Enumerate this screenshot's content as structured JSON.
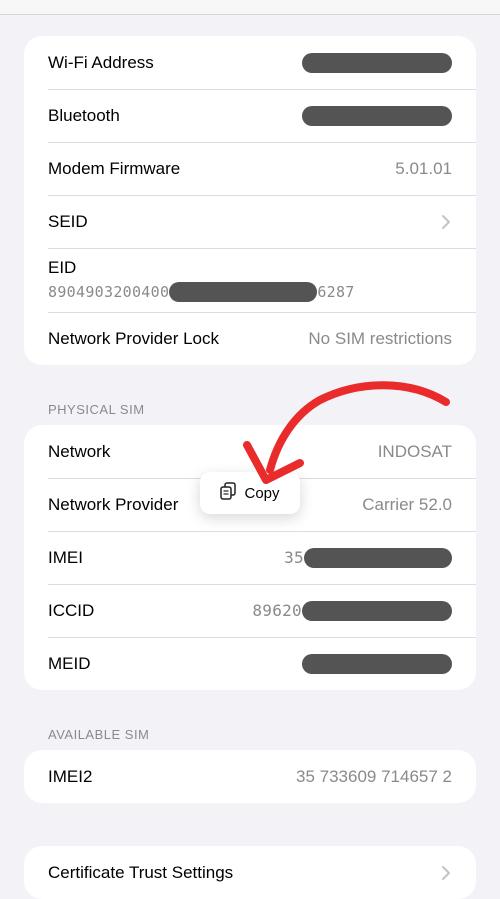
{
  "device_info": {
    "wifi_address_label": "Wi-Fi Address",
    "bluetooth_label": "Bluetooth",
    "modem_firmware_label": "Modem Firmware",
    "modem_firmware_value": "5.01.01",
    "seid_label": "SEID",
    "eid_label": "EID",
    "eid_prefix": "8904903200400",
    "eid_suffix": "6287",
    "network_provider_lock_label": "Network Provider Lock",
    "network_provider_lock_value": "No SIM restrictions"
  },
  "physical_sim": {
    "header": "PHYSICAL SIM",
    "network_label": "Network",
    "network_value": "INDOSAT",
    "network_provider_label": "Network Provider",
    "network_provider_value": "Carrier 52.0",
    "imei_label": "IMEI",
    "imei_prefix": "35",
    "iccid_label": "ICCID",
    "iccid_prefix": "89620",
    "meid_label": "MEID"
  },
  "copy_popup": {
    "label": "Copy",
    "icon": "copy-icon"
  },
  "available_sim": {
    "header": "AVAILABLE SIM",
    "imei2_label": "IMEI2",
    "imei2_value": "35 733609 714657 2"
  },
  "certificate": {
    "label": "Certificate Trust Settings"
  },
  "colors": {
    "background": "#f2f2f7",
    "redaction": "#545454",
    "annotation_arrow": "#ea2b2b",
    "secondary_text": "#8a8a8e"
  }
}
